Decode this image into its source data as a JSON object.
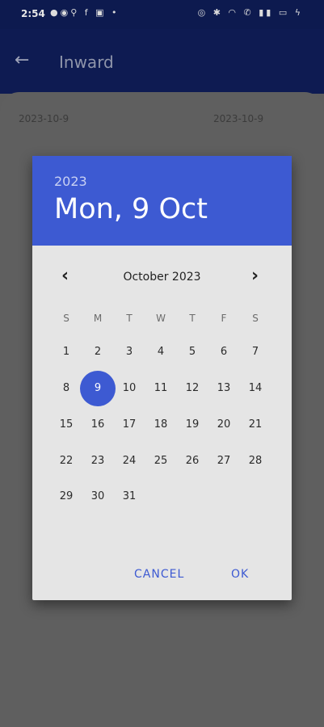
{
  "statusbar": {
    "time": "2:54",
    "left_icons": "●◉⚲ f ▣ •",
    "right_icons": "◎ ✱ ◠ ✆ ▮▮ ▭ ϟ"
  },
  "appbar": {
    "back_icon": "←",
    "title": "Inward"
  },
  "sheet": {
    "date_left": "2023-10-9",
    "date_right": "2023-10-9"
  },
  "dialog": {
    "year": "2023",
    "date_display": "Mon, 9 Oct",
    "month_title": "October 2023",
    "prev_icon": "‹",
    "next_icon": "›",
    "weekdays": [
      "S",
      "M",
      "T",
      "W",
      "T",
      "F",
      "S"
    ],
    "weeks": [
      [
        "1",
        "2",
        "3",
        "4",
        "5",
        "6",
        "7"
      ],
      [
        "8",
        "9",
        "10",
        "11",
        "12",
        "13",
        "14"
      ],
      [
        "15",
        "16",
        "17",
        "18",
        "19",
        "20",
        "21"
      ],
      [
        "22",
        "23",
        "24",
        "25",
        "26",
        "27",
        "28"
      ],
      [
        "29",
        "30",
        "31",
        "",
        "",
        "",
        ""
      ]
    ],
    "selected_day": "9",
    "cancel_label": "CANCEL",
    "ok_label": "OK"
  },
  "colors": {
    "accent": "#3d5ad2",
    "appbar": "#0e1b52"
  }
}
